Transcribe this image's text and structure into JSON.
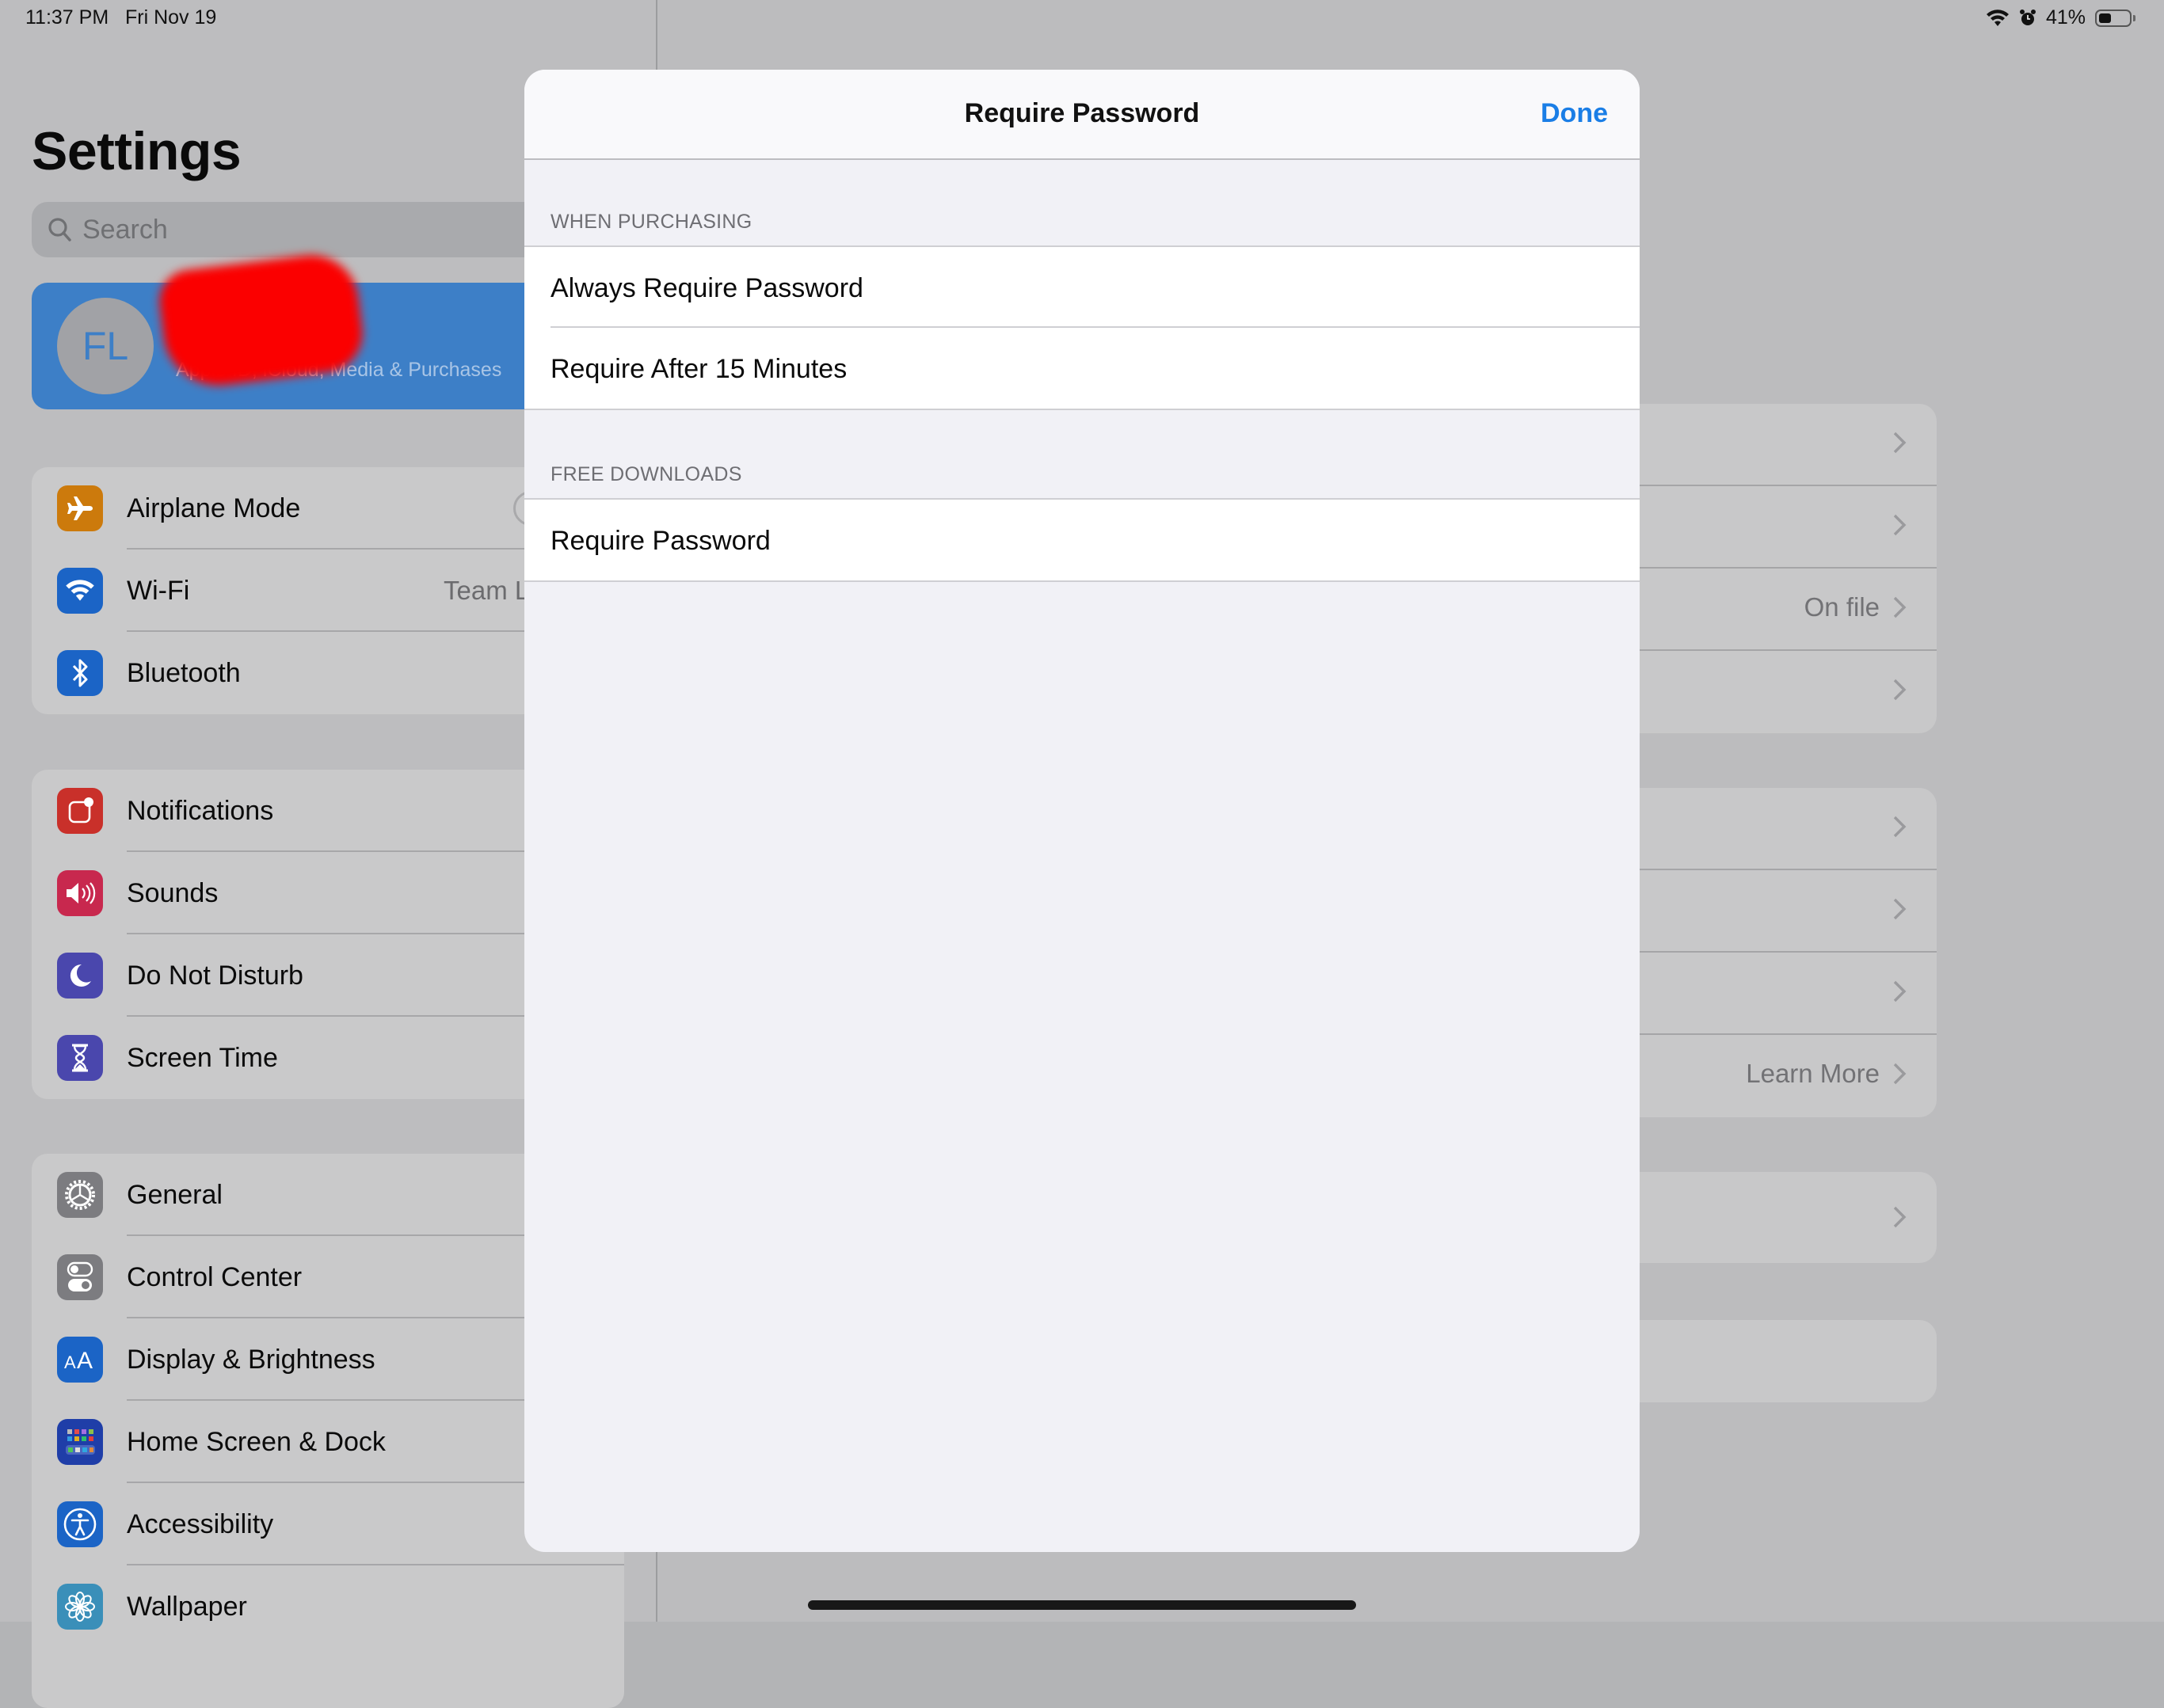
{
  "status_bar": {
    "time": "11:37 PM",
    "date": "Fri Nov 19",
    "battery_percent_label": "41%",
    "battery_level": 0.41,
    "icons": [
      "wifi-icon",
      "alarm-icon",
      "battery-icon"
    ]
  },
  "sidebar": {
    "title": "Settings",
    "search_placeholder": "Search",
    "profile": {
      "initials": "FL",
      "subtitle": "Apple ID, iCloud, Media & Purchases"
    },
    "groups": [
      {
        "items": [
          {
            "label": "Airplane Mode",
            "icon": "airplane-icon",
            "color": "#cc7a0c"
          },
          {
            "label": "Wi-Fi",
            "icon": "wifi-icon",
            "color": "#1b64c6",
            "value": "Team L"
          },
          {
            "label": "Bluetooth",
            "icon": "bluetooth-icon",
            "color": "#1b64c6"
          }
        ]
      },
      {
        "items": [
          {
            "label": "Notifications",
            "icon": "notifications-icon",
            "color": "#c9302a"
          },
          {
            "label": "Sounds",
            "icon": "sounds-icon",
            "color": "#c8284e"
          },
          {
            "label": "Do Not Disturb",
            "icon": "moon-icon",
            "color": "#4a47ad"
          },
          {
            "label": "Screen Time",
            "icon": "hourglass-icon",
            "color": "#4a47ad"
          }
        ]
      },
      {
        "items": [
          {
            "label": "General",
            "icon": "gear-icon",
            "color": "#7c7c80"
          },
          {
            "label": "Control Center",
            "icon": "toggles-icon",
            "color": "#7c7c80"
          },
          {
            "label": "Display & Brightness",
            "icon": "text-size-icon",
            "color": "#1b64c6"
          },
          {
            "label": "Home Screen & Dock",
            "icon": "app-grid-icon",
            "color": "#1f3ea8"
          },
          {
            "label": "Accessibility",
            "icon": "accessibility-icon",
            "color": "#1b64c6"
          },
          {
            "label": "Wallpaper",
            "icon": "flower-icon",
            "color": "#3a8fb9"
          }
        ]
      }
    ]
  },
  "detail": {
    "groups": [
      {
        "rows": [
          {
            "value": ""
          },
          {
            "value": ""
          },
          {
            "value": "On file"
          },
          {
            "value": ""
          }
        ]
      },
      {
        "rows": [
          {
            "value": ""
          },
          {
            "value": ""
          },
          {
            "value": ""
          },
          {
            "value": "Learn More"
          }
        ]
      },
      {
        "rows": [
          {
            "value": ""
          }
        ]
      },
      {
        "rows": []
      }
    ]
  },
  "modal": {
    "title": "Require Password",
    "done_label": "Done",
    "sections": [
      {
        "header": "WHEN PURCHASING",
        "rows": [
          "Always Require Password",
          "Require After 15 Minutes"
        ]
      },
      {
        "header": "FREE DOWNLOADS",
        "rows": [
          "Require Password"
        ]
      }
    ]
  },
  "colors": {
    "accent": "#1a7ee6",
    "profile_card": "#3d7fc7"
  }
}
